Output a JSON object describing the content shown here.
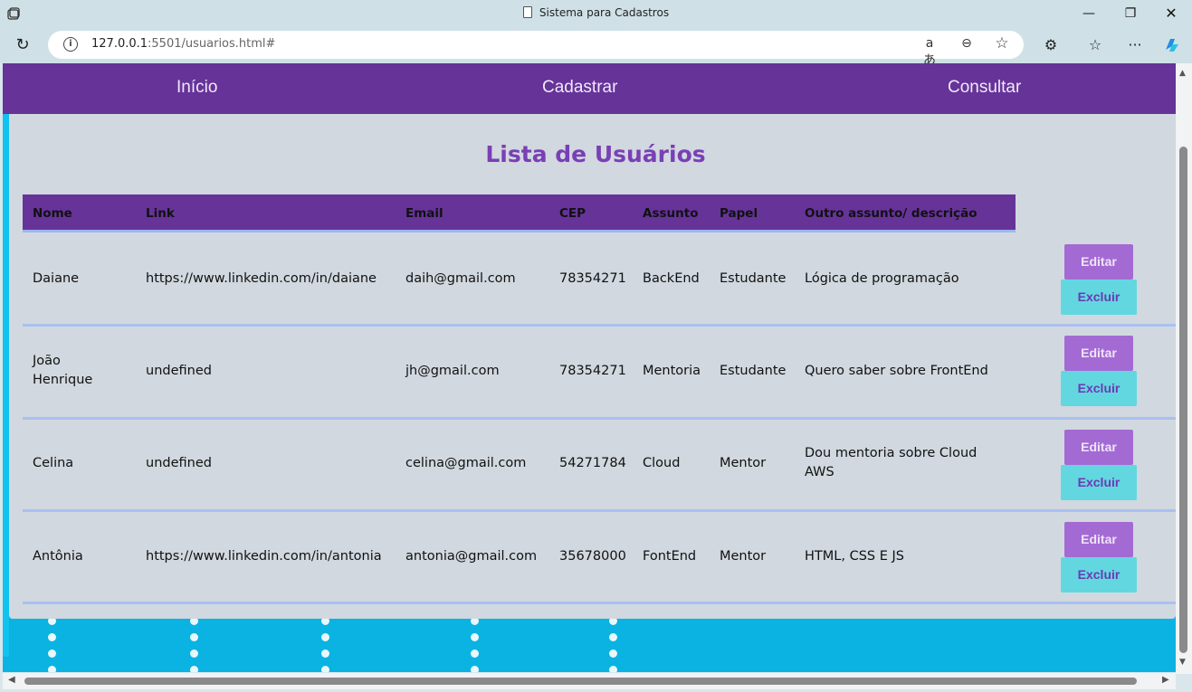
{
  "window": {
    "title": "Sistema para Cadastros",
    "minimize": "—",
    "maximize": "❐",
    "close": "✕"
  },
  "browser": {
    "url_host": "127.0.0.1",
    "url_rest": ":5501/usuarios.html#",
    "read_aloud": "aあ",
    "zoom": "⊖",
    "favorite": "☆",
    "extensions": "⚙",
    "favorites": "☆",
    "more": "···",
    "reload": "↻",
    "info": "i"
  },
  "nav": {
    "items": [
      "Início",
      "Cadastrar",
      "Consultar"
    ]
  },
  "page": {
    "title": "Lista de Usuários"
  },
  "table": {
    "headers": [
      "Nome",
      "Link",
      "Email",
      "CEP",
      "Assunto",
      "Papel",
      "Outro assunto/ descrição"
    ],
    "rows": [
      {
        "nome": "Daiane",
        "link": "https://www.linkedin.com/in/daiane",
        "email": "daih@gmail.com",
        "cep": "78354271",
        "assunto": "BackEnd",
        "papel": "Estudante",
        "outro": "Lógica de programação"
      },
      {
        "nome": "João Henrique",
        "link": "undefined",
        "email": "jh@gmail.com",
        "cep": "78354271",
        "assunto": "Mentoria",
        "papel": "Estudante",
        "outro": "Quero saber sobre FrontEnd"
      },
      {
        "nome": "Celina",
        "link": "undefined",
        "email": "celina@gmail.com",
        "cep": "54271784",
        "assunto": "Cloud",
        "papel": "Mentor",
        "outro": "Dou mentoria sobre Cloud AWS"
      },
      {
        "nome": "Antônia",
        "link": "https://www.linkedin.com/in/antonia",
        "email": "antonia@gmail.com",
        "cep": "35678000",
        "assunto": "FontEnd",
        "papel": "Mentor",
        "outro": "HTML, CSS E JS"
      }
    ],
    "edit_label": "Editar",
    "delete_label": "Excluir"
  },
  "colors": {
    "nav_bg": "#663399",
    "title": "#7a3fb5",
    "edit_btn": "#a46ad4",
    "delete_btn": "#62d7e0",
    "card_bg": "#d1d8df",
    "page_bg": "#0ab3e2"
  }
}
